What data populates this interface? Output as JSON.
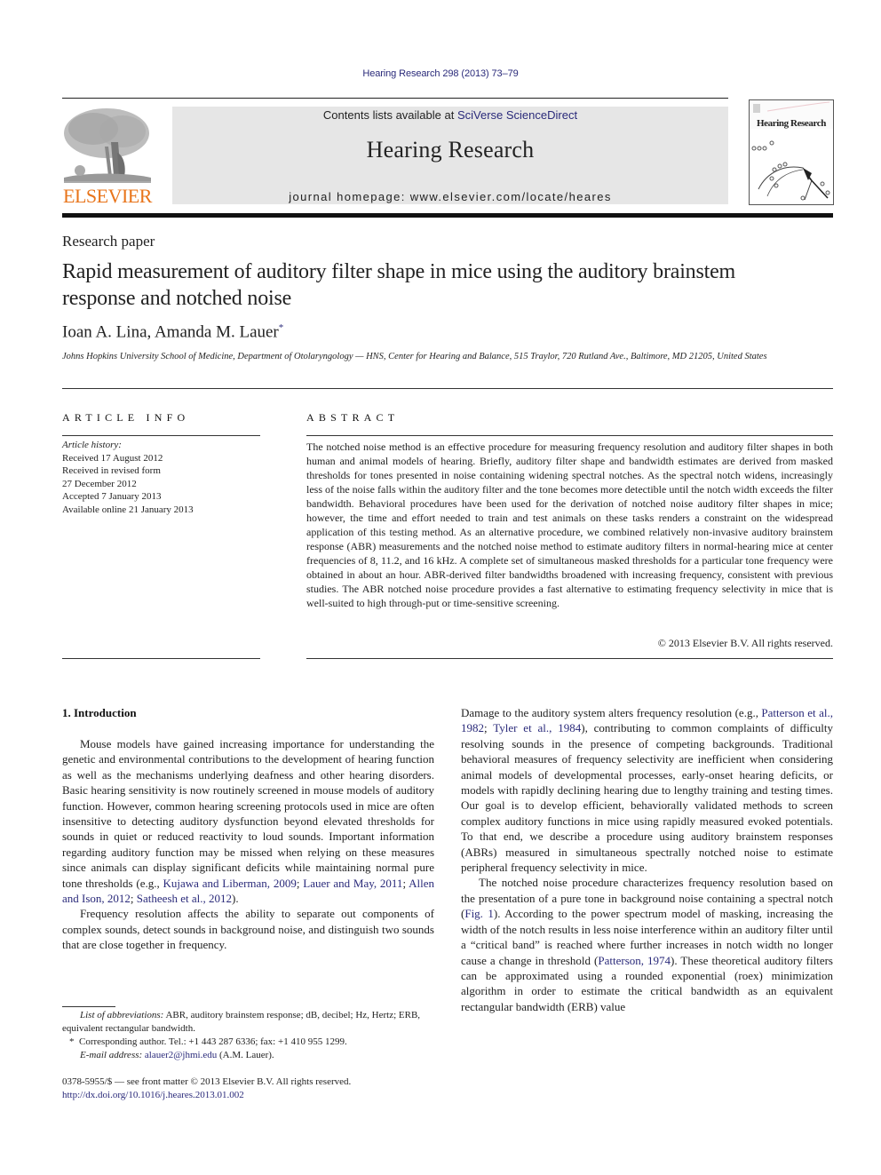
{
  "running_head": "Hearing Research 298 (2013) 73–79",
  "masthead": {
    "publisher_logo_text": "ELSEVIER",
    "contents_prefix": "Contents lists available at ",
    "contents_link": "SciVerse ScienceDirect",
    "journal_name": "Hearing Research",
    "homepage": "journal homepage: www.elsevier.com/locate/heares",
    "cover_title": "Hearing Research",
    "accent_color": "#e8741a",
    "link_color": "#2a2a7a"
  },
  "article": {
    "type": "Research paper",
    "title": "Rapid measurement of auditory filter shape in mice using the auditory brainstem response and notched noise",
    "authors": "Ioan A. Lina, Amanda M. Lauer",
    "author_mark": "*",
    "affiliation": "Johns Hopkins University School of Medicine, Department of Otolaryngology — HNS, Center for Hearing and Balance, 515 Traylor, 720 Rutland Ave., Baltimore, MD 21205, United States"
  },
  "article_info": {
    "heading": "ARTICLE INFO",
    "history_label": "Article history:",
    "history": [
      "Received 17 August 2012",
      "Received in revised form",
      "27 December 2012",
      "Accepted 7 January 2013",
      "Available online 21 January 2013"
    ]
  },
  "abstract": {
    "heading": "ABSTRACT",
    "text": "The notched noise method is an effective procedure for measuring frequency resolution and auditory filter shapes in both human and animal models of hearing. Briefly, auditory filter shape and bandwidth estimates are derived from masked thresholds for tones presented in noise containing widening spectral notches. As the spectral notch widens, increasingly less of the noise falls within the auditory filter and the tone becomes more detectible until the notch width exceeds the filter bandwidth. Behavioral procedures have been used for the derivation of notched noise auditory filter shapes in mice; however, the time and effort needed to train and test animals on these tasks renders a constraint on the widespread application of this testing method. As an alternative procedure, we combined relatively non-invasive auditory brainstem response (ABR) measurements and the notched noise method to estimate auditory filters in normal-hearing mice at center frequencies of 8, 11.2, and 16 kHz. A complete set of simultaneous masked thresholds for a particular tone frequency were obtained in about an hour. ABR-derived filter bandwidths broadened with increasing frequency, consistent with previous studies. The ABR notched noise procedure provides a fast alternative to estimating frequency selectivity in mice that is well-suited to high through-put or time-sensitive screening.",
    "copyright": "© 2013 Elsevier B.V. All rights reserved."
  },
  "introduction": {
    "heading": "1.  Introduction",
    "left_p1_text": "Mouse models have gained increasing importance for understanding the genetic and environmental contributions to the development of hearing function as well as the mechanisms underlying deafness and other hearing disorders. Basic hearing sensitivity is now routinely screened in mouse models of auditory function. However, common hearing screening protocols used in mice are often insensitive to detecting auditory dysfunction beyond elevated thresholds for sounds in quiet or reduced reactivity to loud sounds. Important information regarding auditory function may be missed when relying on these measures since animals can display significant deficits while maintaining normal pure tone thresholds (e.g., ",
    "left_p1_refs": [
      "Kujawa and Liberman, 2009",
      "Lauer and May, 2011",
      "Allen and Ison, 2012",
      "Satheesh et al., 2012"
    ],
    "left_p1_end": ").",
    "left_p2": "Frequency resolution affects the ability to separate out components of complex sounds, detect sounds in background noise, and distinguish two sounds that are close together in frequency.",
    "right_p1_a": "Damage to the auditory system alters frequency resolution (e.g., ",
    "right_p1_refs": [
      "Patterson et al., 1982",
      "Tyler et al., 1984"
    ],
    "right_p1_b": "), contributing to common complaints of difficulty resolving sounds in the presence of competing backgrounds. Traditional behavioral measures of frequency selectivity are inefficient when considering animal models of developmental processes, early-onset hearing deficits, or models with rapidly declining hearing due to lengthy training and testing times. Our goal is to develop efficient, behaviorally validated methods to screen complex auditory functions in mice using rapidly measured evoked potentials. To that end, we describe a procedure using auditory brainstem responses (ABRs) measured in simultaneous spectrally notched noise to estimate peripheral frequency selectivity in mice.",
    "right_p2_a": "The notched noise procedure characterizes frequency resolution based on the presentation of a pure tone in background noise containing a spectral notch (",
    "right_p2_ref1": "Fig. 1",
    "right_p2_b": "). According to the power spectrum model of masking, increasing the width of the notch results in less noise interference within an auditory filter until a “critical band” is reached where further increases in notch width no longer cause a change in threshold (",
    "right_p2_ref2": "Patterson, 1974",
    "right_p2_c": "). These theoretical auditory filters can be approximated using a rounded exponential (roex) minimization algorithm in order to estimate the critical bandwidth as an equivalent rectangular bandwidth (ERB) value"
  },
  "footnotes": {
    "abbrev_label": "List of abbreviations:",
    "abbrev_text": " ABR, auditory brainstem response; dB, decibel; Hz, Hertz; ERB, equivalent rectangular bandwidth.",
    "corr_mark": "*",
    "corr_text": "Corresponding author. Tel.: +1 443 287 6336; fax: +1 410 955 1299.",
    "email_label": "E-mail address:",
    "email": "alauer2@jhmi.edu",
    "email_suffix": " (A.M. Lauer)."
  },
  "bottom": {
    "issn_line": "0378-5955/$ — see front matter © 2013 Elsevier B.V. All rights reserved.",
    "doi": "http://dx.doi.org/10.1016/j.heares.2013.01.002"
  }
}
